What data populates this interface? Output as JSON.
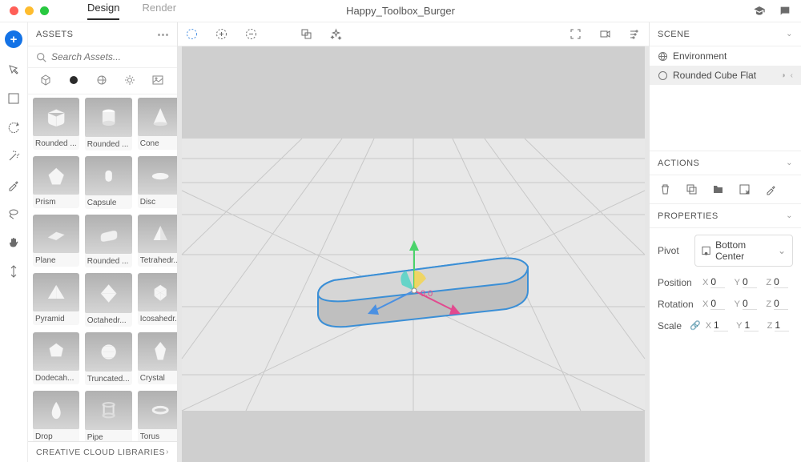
{
  "title": "Happy_Toolbox_Burger",
  "tabs": {
    "design": "Design",
    "render": "Render"
  },
  "assets_panel": {
    "title": "ASSETS",
    "search_placeholder": "Search Assets...",
    "libraries_title": "CREATIVE CLOUD LIBRARIES",
    "categories": [
      "models",
      "materials",
      "environments",
      "lights",
      "images"
    ],
    "items": [
      {
        "label": "Rounded ...",
        "shape": "rounded-cube"
      },
      {
        "label": "Rounded ...",
        "shape": "cylinder"
      },
      {
        "label": "Cone",
        "shape": "cone"
      },
      {
        "label": "Prism",
        "shape": "prism"
      },
      {
        "label": "Capsule",
        "shape": "capsule"
      },
      {
        "label": "Disc",
        "shape": "disc"
      },
      {
        "label": "Plane",
        "shape": "plane"
      },
      {
        "label": "Rounded ...",
        "shape": "rounded-flat"
      },
      {
        "label": "Tetrahedr...",
        "shape": "tetra"
      },
      {
        "label": "Pyramid",
        "shape": "pyramid"
      },
      {
        "label": "Octahedr...",
        "shape": "octa"
      },
      {
        "label": "Icosahedr...",
        "shape": "ico"
      },
      {
        "label": "Dodecah...",
        "shape": "dodec"
      },
      {
        "label": "Truncated...",
        "shape": "trunc"
      },
      {
        "label": "Crystal",
        "shape": "crystal"
      },
      {
        "label": "Drop",
        "shape": "drop"
      },
      {
        "label": "Pipe",
        "shape": "pipe"
      },
      {
        "label": "Torus",
        "shape": "torus"
      }
    ]
  },
  "viewport": {
    "gizmo_label": "0.0"
  },
  "scene": {
    "title": "SCENE",
    "items": [
      {
        "label": "Environment",
        "icon": "globe",
        "selected": false
      },
      {
        "label": "Rounded Cube Flat",
        "icon": "mesh",
        "selected": true
      }
    ]
  },
  "actions": {
    "title": "ACTIONS"
  },
  "properties": {
    "title": "PROPERTIES",
    "pivot_label": "Pivot",
    "pivot_value": "Bottom Center",
    "position_label": "Position",
    "rotation_label": "Rotation",
    "scale_label": "Scale",
    "position": {
      "x": "0",
      "y": "0",
      "z": "0"
    },
    "rotation": {
      "x": "0",
      "y": "0",
      "z": "0"
    },
    "scale": {
      "x": "1",
      "y": "1",
      "z": "1"
    }
  }
}
